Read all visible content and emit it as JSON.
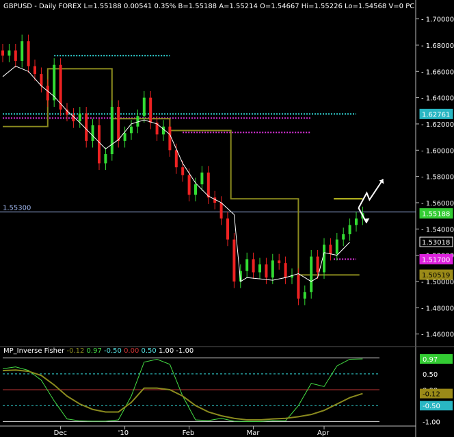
{
  "header": {
    "symbol": "GBPUSD",
    "period": "Daily",
    "market": "FOREX",
    "last": "L=1.55188",
    "change": "0.00541",
    "change_pct": "0.35%",
    "bid": "B=1.55188",
    "ask": "A=1.55214",
    "open": "O=1.54667",
    "high": "Hi=1.55226",
    "low": "Lo=1.54568",
    "volume": "V=0",
    "truncated": "PC"
  },
  "indicator_panel": {
    "name": "MP_Inverse Fisher",
    "values": [
      "-0.12",
      "0.97",
      "-0.50",
      "0.00",
      "0.50",
      "1.00",
      "-1.00"
    ],
    "value_colors": [
      "#8a8a1e",
      "#44dd44",
      "#55dddd",
      "#cc3333",
      "#55dddd",
      "#ffffff",
      "#ffffff"
    ]
  },
  "chart_data": [
    {
      "type": "candlestick",
      "title": "GBPUSD Daily FOREX",
      "y_ticks": [
        "1.70000",
        "1.68000",
        "1.66000",
        "1.64000",
        "1.62000",
        "1.60000",
        "1.58000",
        "1.56000",
        "1.54000",
        "1.52000",
        "1.50000",
        "1.48000",
        "1.46000"
      ],
      "ylim": [
        1.452,
        1.705
      ],
      "x_ticks": [
        "Dec",
        "'10",
        "Feb",
        "Mar",
        "Apr"
      ],
      "x_tick_days": [
        18,
        38,
        58,
        78,
        100
      ],
      "x_range": [
        0,
        120
      ],
      "series": [
        {
          "name": "close",
          "x": [
            0,
            2,
            4,
            6,
            8,
            10,
            12,
            14,
            16,
            18,
            20,
            22,
            24,
            26,
            28,
            30,
            32,
            34,
            36,
            38,
            40,
            42,
            44,
            46,
            48,
            50,
            52,
            54,
            56,
            58,
            60,
            62,
            64,
            66,
            68,
            70,
            72,
            74,
            76,
            78,
            80,
            82,
            84,
            86,
            88,
            90,
            92,
            94,
            96,
            98,
            100,
            102,
            104,
            106,
            108,
            110,
            112
          ],
          "values": [
            1.672,
            1.676,
            1.668,
            1.683,
            1.664,
            1.658,
            1.649,
            1.638,
            1.665,
            1.631,
            1.627,
            1.622,
            1.628,
            1.607,
            1.619,
            1.59,
            1.597,
            1.633,
            1.607,
            1.613,
            1.618,
            1.626,
            1.64,
            1.621,
            1.612,
            1.618,
            1.6,
            1.587,
            1.581,
            1.566,
            1.574,
            1.583,
            1.564,
            1.56,
            1.548,
            1.532,
            1.5,
            1.508,
            1.517,
            1.507,
            1.513,
            1.503,
            1.516,
            1.514,
            1.503,
            1.505,
            1.487,
            1.492,
            1.519,
            1.507,
            1.528,
            1.521,
            1.532,
            1.536,
            1.543,
            1.548,
            1.552
          ]
        },
        {
          "name": "moving average",
          "x": [
            0,
            4,
            8,
            12,
            16,
            20,
            24,
            28,
            32,
            36,
            40,
            44,
            48,
            52,
            56,
            60,
            64,
            68,
            72,
            74,
            76,
            80,
            84,
            88,
            92,
            96,
            98,
            100,
            104,
            108
          ],
          "values": [
            1.656,
            1.664,
            1.66,
            1.649,
            1.641,
            1.63,
            1.621,
            1.611,
            1.601,
            1.608,
            1.62,
            1.623,
            1.62,
            1.612,
            1.59,
            1.575,
            1.565,
            1.56,
            1.551,
            1.5,
            1.503,
            1.502,
            1.501,
            1.503,
            1.506,
            1.5,
            1.503,
            1.522,
            1.52,
            1.53
          ]
        },
        {
          "name": "step line",
          "x": [
            0,
            14,
            14,
            34,
            34,
            52,
            52,
            71,
            71,
            92,
            92,
            111
          ],
          "values": [
            1.618,
            1.618,
            1.662,
            1.662,
            1.624,
            1.624,
            1.615,
            1.615,
            1.563,
            1.563,
            1.505,
            1.505
          ]
        }
      ],
      "levels": [
        {
          "value": 1.672,
          "from": 16,
          "to": 52,
          "color": "#33dddd"
        },
        {
          "value": 1.6276,
          "from": 0,
          "to": 110,
          "color": "#33dddd"
        },
        {
          "value": 1.6245,
          "from": 0,
          "to": 96,
          "color": "#dd33dd"
        },
        {
          "value": 1.6135,
          "from": 56,
          "to": 96,
          "color": "#dd33dd"
        },
        {
          "value": 1.517,
          "from": 103,
          "to": 110,
          "color": "#dd33dd"
        },
        {
          "value": 1.563,
          "from": 103,
          "to": 112,
          "color": "#cccc22"
        }
      ],
      "hline": {
        "value": 1.553,
        "label": "1.55300",
        "color": "#a0b8f0"
      },
      "price_labels": [
        {
          "text": "1.62761",
          "value": 1.62761,
          "bg": "#29b6c2",
          "fg": "#ffffff"
        },
        {
          "text": "1.55188",
          "value": 1.55188,
          "bg": "#33cc33",
          "fg": "#ffffff"
        },
        {
          "text": "1.53018",
          "value": 1.53018,
          "bg": "#000000",
          "fg": "#ffffff"
        },
        {
          "text": "1.51700",
          "value": 1.517,
          "bg": "#dd22dd",
          "fg": "#ffffff"
        },
        {
          "text": "1.50519",
          "value": 1.50519,
          "bg": "#9a8a18",
          "fg": "#000000"
        }
      ],
      "colors": {
        "up": "#33dd33",
        "down": "#ee2222",
        "ma": "#ffffff",
        "step": "#8a8a1e"
      }
    },
    {
      "type": "line",
      "title": "MP_Inverse Fisher",
      "y_ticks": [
        "1.00",
        "0.97",
        "0.50",
        "0.00",
        "-0.12",
        "-0.50",
        "-1.00"
      ],
      "ylim": [
        -1.1,
        1.1
      ],
      "x_range": [
        0,
        120
      ],
      "levels": [
        {
          "value": 1.0,
          "color": "#dddddd"
        },
        {
          "value": 0.5,
          "color": "#33dddd",
          "dashed": true
        },
        {
          "value": 0.0,
          "color": "#bb3333"
        },
        {
          "value": -0.5,
          "color": "#33dddd",
          "dashed": true
        },
        {
          "value": -1.0,
          "color": "#dddddd"
        }
      ],
      "series": [
        {
          "name": "fast",
          "color": "#44dd44",
          "x": [
            0,
            4,
            8,
            12,
            16,
            20,
            24,
            28,
            32,
            36,
            40,
            44,
            48,
            52,
            56,
            60,
            64,
            68,
            72,
            76,
            80,
            84,
            88,
            92,
            96,
            100,
            104,
            108,
            112
          ],
          "values": [
            0.66,
            0.72,
            0.61,
            0.3,
            -0.35,
            -0.92,
            -0.98,
            -0.99,
            -0.99,
            -0.95,
            -0.2,
            0.87,
            0.96,
            0.8,
            -0.2,
            -0.95,
            -0.97,
            -0.9,
            -0.99,
            -1.0,
            -1.0,
            -0.97,
            -0.98,
            -0.5,
            0.2,
            0.1,
            0.75,
            0.96,
            0.97
          ]
        },
        {
          "name": "slow",
          "color": "#8a8a1e",
          "x": [
            0,
            4,
            8,
            12,
            16,
            20,
            24,
            28,
            32,
            36,
            40,
            44,
            48,
            52,
            56,
            60,
            64,
            68,
            72,
            76,
            80,
            84,
            88,
            92,
            96,
            100,
            104,
            108,
            112
          ],
          "values": [
            0.6,
            0.62,
            0.58,
            0.45,
            0.15,
            -0.2,
            -0.45,
            -0.62,
            -0.7,
            -0.7,
            -0.4,
            0.05,
            0.05,
            0.0,
            -0.2,
            -0.5,
            -0.7,
            -0.82,
            -0.9,
            -0.95,
            -0.95,
            -0.92,
            -0.9,
            -0.85,
            -0.78,
            -0.65,
            -0.45,
            -0.25,
            -0.12
          ]
        }
      ],
      "value_labels": [
        {
          "text": "0.97",
          "value": 0.97,
          "bg": "#33cc33",
          "fg": "#ffffff"
        },
        {
          "text": "0.50",
          "value": 0.5,
          "bg": "#000000",
          "fg": "#ffffff"
        },
        {
          "text": "0.00",
          "value": 0.0,
          "bg": "#000000",
          "fg": "#ffffff"
        },
        {
          "text": "-0.12",
          "value": -0.12,
          "bg": "#9a8a18",
          "fg": "#000000"
        },
        {
          "text": "-0.50",
          "value": -0.5,
          "bg": "#29b6c2",
          "fg": "#ffffff"
        },
        {
          "text": "-1.00",
          "value": -1.0,
          "bg": "#000000",
          "fg": "#ffffff"
        }
      ]
    }
  ]
}
